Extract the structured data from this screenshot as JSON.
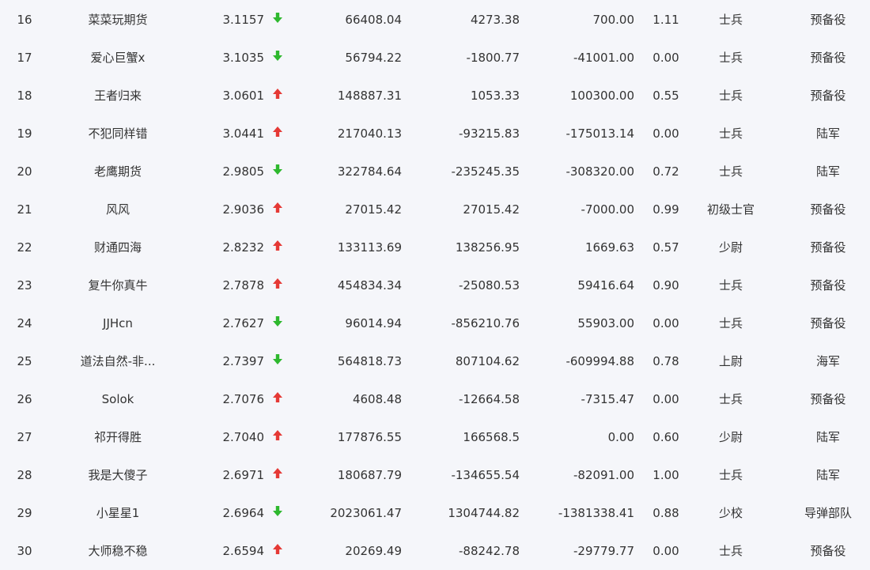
{
  "colors": {
    "up": "#e53935",
    "down": "#2eb82e",
    "text": "#333333",
    "background": "#f5f6fa"
  },
  "rows": [
    {
      "rank": "16",
      "name": "菜菜玩期货",
      "score": "3.1157",
      "trend": "down",
      "trend_icon": "down-arrow-icon",
      "v1": "66408.04",
      "v2": "4273.38",
      "v3": "700.00",
      "ratio": "1.11",
      "level": "士兵",
      "branch": "预备役"
    },
    {
      "rank": "17",
      "name": "爱心巨蟹x",
      "score": "3.1035",
      "trend": "down",
      "trend_icon": "down-arrow-icon",
      "v1": "56794.22",
      "v2": "-1800.77",
      "v3": "-41001.00",
      "ratio": "0.00",
      "level": "士兵",
      "branch": "预备役"
    },
    {
      "rank": "18",
      "name": "王者归来",
      "score": "3.0601",
      "trend": "up",
      "trend_icon": "up-arrow-icon",
      "v1": "148887.31",
      "v2": "1053.33",
      "v3": "100300.00",
      "ratio": "0.55",
      "level": "士兵",
      "branch": "预备役"
    },
    {
      "rank": "19",
      "name": "不犯同样错",
      "score": "3.0441",
      "trend": "up",
      "trend_icon": "up-arrow-icon",
      "v1": "217040.13",
      "v2": "-93215.83",
      "v3": "-175013.14",
      "ratio": "0.00",
      "level": "士兵",
      "branch": "陆军"
    },
    {
      "rank": "20",
      "name": "老鹰期货",
      "score": "2.9805",
      "trend": "down",
      "trend_icon": "down-arrow-icon",
      "v1": "322784.64",
      "v2": "-235245.35",
      "v3": "-308320.00",
      "ratio": "0.72",
      "level": "士兵",
      "branch": "陆军"
    },
    {
      "rank": "21",
      "name": "风风",
      "score": "2.9036",
      "trend": "up",
      "trend_icon": "up-arrow-icon",
      "v1": "27015.42",
      "v2": "27015.42",
      "v3": "-7000.00",
      "ratio": "0.99",
      "level": "初级士官",
      "branch": "预备役"
    },
    {
      "rank": "22",
      "name": "财通四海",
      "score": "2.8232",
      "trend": "up",
      "trend_icon": "up-arrow-icon",
      "v1": "133113.69",
      "v2": "138256.95",
      "v3": "1669.63",
      "ratio": "0.57",
      "level": "少尉",
      "branch": "预备役"
    },
    {
      "rank": "23",
      "name": "复牛你真牛",
      "score": "2.7878",
      "trend": "up",
      "trend_icon": "up-arrow-icon",
      "v1": "454834.34",
      "v2": "-25080.53",
      "v3": "59416.64",
      "ratio": "0.90",
      "level": "士兵",
      "branch": "预备役"
    },
    {
      "rank": "24",
      "name": "JJHcn",
      "score": "2.7627",
      "trend": "down",
      "trend_icon": "down-arrow-icon",
      "v1": "96014.94",
      "v2": "-856210.76",
      "v3": "55903.00",
      "ratio": "0.00",
      "level": "士兵",
      "branch": "预备役"
    },
    {
      "rank": "25",
      "name": "道法自然-非...",
      "score": "2.7397",
      "trend": "down",
      "trend_icon": "down-arrow-icon",
      "v1": "564818.73",
      "v2": "807104.62",
      "v3": "-609994.88",
      "ratio": "0.78",
      "level": "上尉",
      "branch": "海军"
    },
    {
      "rank": "26",
      "name": "Solok",
      "score": "2.7076",
      "trend": "up",
      "trend_icon": "up-arrow-icon",
      "v1": "4608.48",
      "v2": "-12664.58",
      "v3": "-7315.47",
      "ratio": "0.00",
      "level": "士兵",
      "branch": "预备役"
    },
    {
      "rank": "27",
      "name": "祁开得胜",
      "score": "2.7040",
      "trend": "up",
      "trend_icon": "up-arrow-icon",
      "v1": "177876.55",
      "v2": "166568.5",
      "v3": "0.00",
      "ratio": "0.60",
      "level": "少尉",
      "branch": "陆军"
    },
    {
      "rank": "28",
      "name": "我是大傻子",
      "score": "2.6971",
      "trend": "up",
      "trend_icon": "up-arrow-icon",
      "v1": "180687.79",
      "v2": "-134655.54",
      "v3": "-82091.00",
      "ratio": "1.00",
      "level": "士兵",
      "branch": "陆军"
    },
    {
      "rank": "29",
      "name": "小星星1",
      "score": "2.6964",
      "trend": "down",
      "trend_icon": "down-arrow-icon",
      "v1": "2023061.47",
      "v2": "1304744.82",
      "v3": "-1381338.41",
      "ratio": "0.88",
      "level": "少校",
      "branch": "导弹部队"
    },
    {
      "rank": "30",
      "name": "大师稳不稳",
      "score": "2.6594",
      "trend": "up",
      "trend_icon": "up-arrow-icon",
      "v1": "20269.49",
      "v2": "-88242.78",
      "v3": "-29779.77",
      "ratio": "0.00",
      "level": "士兵",
      "branch": "预备役"
    }
  ]
}
